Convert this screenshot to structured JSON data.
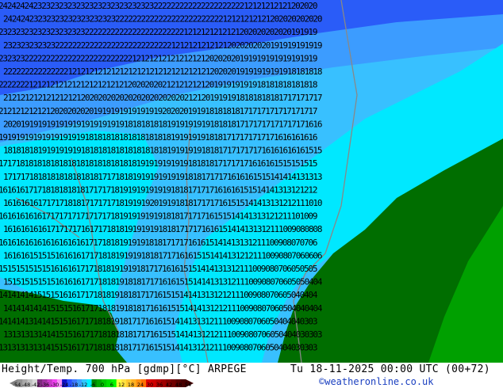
{
  "map": {
    "title": "Height/Temp. 700 hPa [gdmp][°C] ARPEGE",
    "valid_time": "Tu 18-11-2025 00:00 UTC (00+72)",
    "credit": "©weatheronline.co.uk",
    "colors": {
      "deep_blue": "#2a5cf8",
      "blue": "#3c9cff",
      "light_blue": "#38c0ff",
      "cyan": "#00e8ff",
      "dark_green": "#006e00",
      "green": "#00a000",
      "border": "#888888"
    },
    "label_rows": [
      "24242424232323232323232323232323232322222222222222222222212121212121202020",
      "24242423232323232323232323222222222222222222222222212121212121202020202020",
      "23232323232323232323222222222222222222222221212121212121202020202020191919",
      "23232323232322222222222222222222222222212121212121212020202020191919191919",
      "23232322222222222222222222222221212121212121212120202020191919191919191919",
      "22222222222222212121212121212121212121212121212120202019191919191918181818",
      "22222221212121212121212121212120202020212121212120191919191918181818181818",
      "21212121212121212120202020202020202020202021212019191918181818181717171717",
      "21212121212120202020201919191919191919202020191918181818171717171717171717",
      "20201919191919191919191919191818181818191919191918181817171717171717171616",
      "19191919191919191919181818181818181818181919191918181717171717171616161616",
      "18181818191919191918181818181818181818191919191818171717171716161616161515",
      "17171818181818181818181818181818191919191919181818171717171616161515151515",
      "17171718181818181818181717181819191919191918181717171616161515141414131313",
      "16161617171818181818171717181919191919191818171717161616151514141313121212",
      "16161616171717181817171717181919192019191818171717161515141413131212111010",
      "16161616161717171717171717181919191919181817171716151514141313121211101009",
      "16161616161717171716171718181919191918181717171616151414131312111009080808",
      "16161616161616161616171718181919191818171717161615141413131211100908070706",
      "16161615151516161617171818191919181817171616151514141312121110090807060606",
      "15151515151516161617171818191919181717161615151414131312111009080706050505",
      "15151515151516161617171818191818171716161515141413131211100908070605050404",
      "14141414151515161617171818191818171716151514141313121211100908070605040404",
      "14141414141515151617171818191818171616151514141312121110090807060504040404",
      "14141413141415151617171818191817171616151414131312111009080706050404040303",
      "13131313141415151617171818181817171615151414131212111009080706050404030303",
      "13131313131415151617171818181817171615151414131212111009080706050404030303"
    ]
  },
  "legend": {
    "ticks": [
      "-54",
      "-48",
      "-42",
      "-36",
      "-30",
      "-24",
      "-18",
      "-12",
      "-6",
      "0",
      "6",
      "12",
      "18",
      "24",
      "30",
      "36",
      "42",
      "48",
      "54"
    ],
    "colors": [
      "#909090",
      "#a8a8a8",
      "#c0c0c0",
      "#d8d8d8",
      "#7c2c7c",
      "#a030a0",
      "#c838c8",
      "#f040f0",
      "#f890f8",
      "#1010c8",
      "#2850ff",
      "#3c78ff",
      "#3ca0ff",
      "#30c8ff",
      "#00f0ff",
      "#008800",
      "#00a800",
      "#00c800",
      "#00e000",
      "#00f800",
      "#ffff40",
      "#ffe040",
      "#ffc830",
      "#ffb020",
      "#ff9010",
      "#ff7000",
      "#e00000",
      "#d00000",
      "#b80000",
      "#a00000",
      "#880000",
      "#700000",
      "#5a0000",
      "#480000"
    ]
  }
}
